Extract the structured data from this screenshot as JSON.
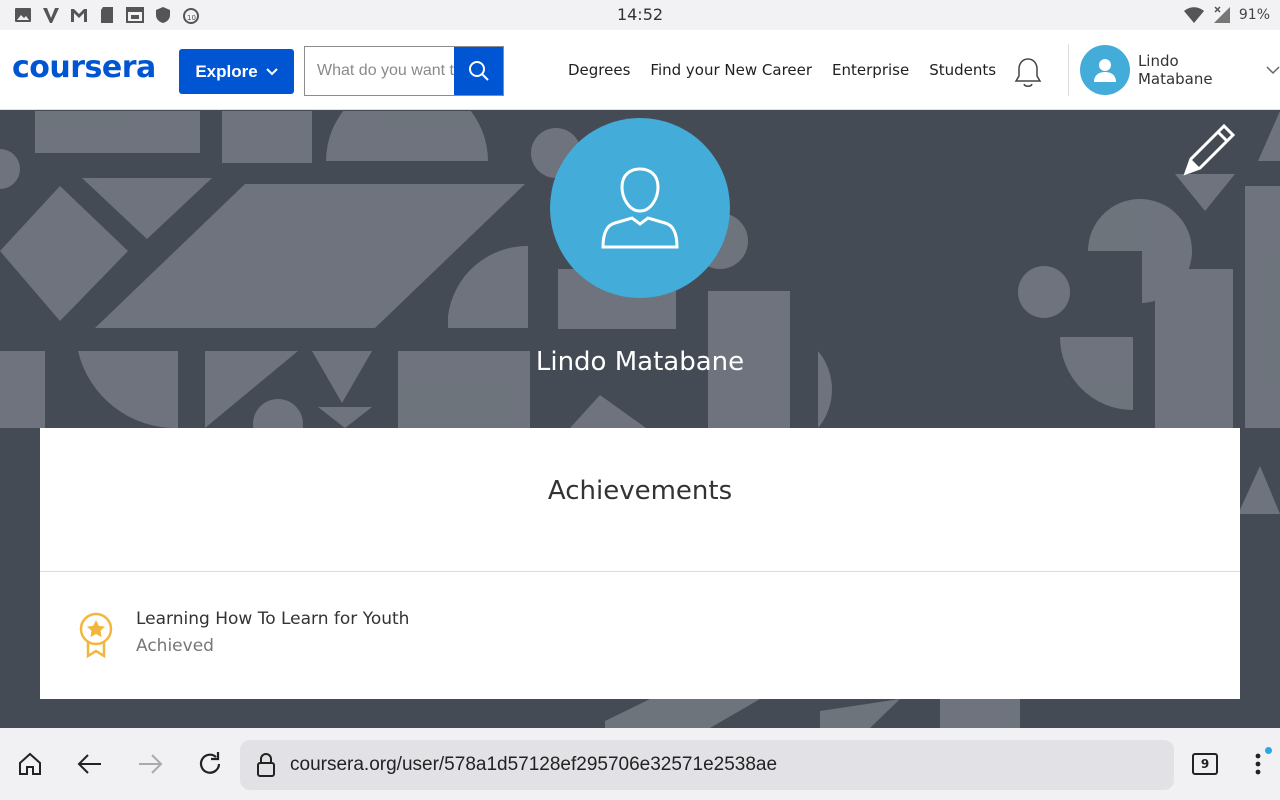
{
  "status_bar": {
    "time": "14:52",
    "battery": "91%",
    "left_icons": [
      "image-icon",
      "v-icon",
      "gmail-icon",
      "sd-card-icon",
      "calendar-icon",
      "shield-icon",
      "timer-icon"
    ],
    "right_icons": [
      "wifi-icon",
      "signal-icon"
    ]
  },
  "nav": {
    "logo": "coursera",
    "explore_label": "Explore",
    "search_placeholder": "What do you want to learn?",
    "links": [
      "Degrees",
      "Find your New Career",
      "Enterprise",
      "Students"
    ],
    "user_name": "Lindo Matabane"
  },
  "profile": {
    "name": "Lindo Matabane"
  },
  "achievements": {
    "title": "Achievements",
    "items": [
      {
        "name": "Learning How To Learn for Youth",
        "status": "Achieved"
      }
    ]
  },
  "browser": {
    "url": "coursera.org/user/578a1d57128ef295706e32571e2538ae",
    "tab_count": "9"
  },
  "colors": {
    "brand": "#0056d2",
    "avatar": "#43acd9",
    "banner_bg": "#454b55",
    "badge": "#f2b63c"
  }
}
